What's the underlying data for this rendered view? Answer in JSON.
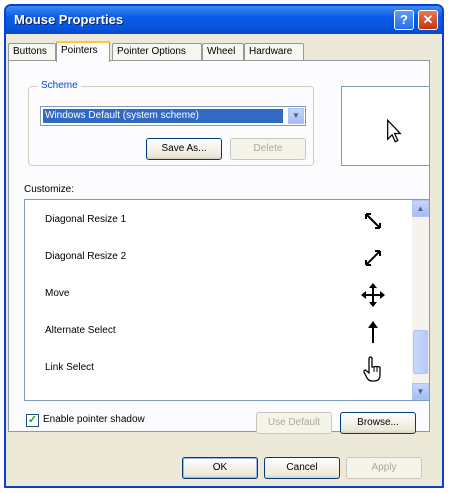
{
  "window": {
    "title": "Mouse Properties",
    "help_label": "?",
    "close_label": "✕"
  },
  "tabs": [
    {
      "label": "Buttons"
    },
    {
      "label": "Pointers"
    },
    {
      "label": "Pointer Options"
    },
    {
      "label": "Wheel"
    },
    {
      "label": "Hardware"
    }
  ],
  "active_tab": "Pointers",
  "scheme": {
    "group_label": "Scheme",
    "selected": "Windows Default (system scheme)",
    "save_as_label": "Save As...",
    "delete_label": "Delete"
  },
  "customize": {
    "label": "Customize:",
    "items": [
      {
        "label": "Diagonal Resize 1",
        "icon": "diagonal-resize-1-icon"
      },
      {
        "label": "Diagonal Resize 2",
        "icon": "diagonal-resize-2-icon"
      },
      {
        "label": "Move",
        "icon": "move-icon"
      },
      {
        "label": "Alternate Select",
        "icon": "up-arrow-icon"
      },
      {
        "label": "Link Select",
        "icon": "hand-icon"
      }
    ]
  },
  "shadow": {
    "label": "Enable pointer shadow",
    "checked": true
  },
  "buttons": {
    "use_default": "Use Default",
    "browse": "Browse...",
    "ok": "OK",
    "cancel": "Cancel",
    "apply": "Apply"
  }
}
